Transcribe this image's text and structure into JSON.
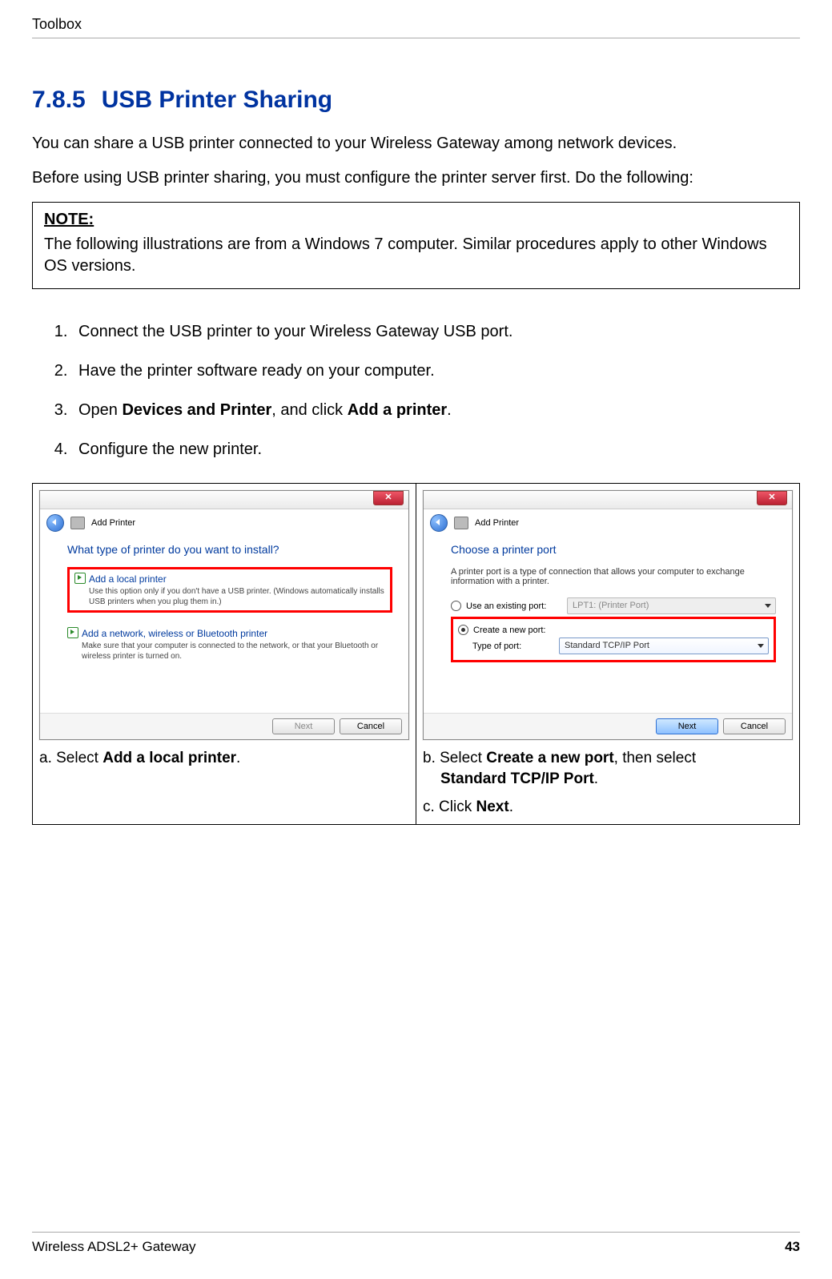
{
  "header": {
    "section": "Toolbox"
  },
  "heading": {
    "number": "7.8.5",
    "title": "USB Printer Sharing"
  },
  "intro1": "You can share a USB printer connected to your Wireless Gateway among network devices.",
  "intro2": "Before using USB printer sharing, you must configure the printer server first. Do the following:",
  "note": {
    "label": "NOTE:",
    "text": "The following illustrations are from a Windows 7 computer. Similar procedures apply to other Windows OS versions."
  },
  "steps": {
    "s1": "Connect the USB printer to your Wireless Gateway USB port.",
    "s2": "Have the printer software ready on your computer.",
    "s3_a": "Open ",
    "s3_b": "Devices and Printer",
    "s3_c": ", and click ",
    "s3_d": "Add a printer",
    "s3_e": ".",
    "s4": "Configure the new printer."
  },
  "dialogA": {
    "window_title": "Add Printer",
    "heading": "What type of printer do you want to install?",
    "opt1_title": "Add a local printer",
    "opt1_desc": "Use this option only if you don't have a USB printer. (Windows automatically installs USB printers when you plug them in.)",
    "opt2_title": "Add a network, wireless or Bluetooth printer",
    "opt2_desc": "Make sure that your computer is connected to the network, or that your Bluetooth or wireless printer is turned on.",
    "btn_next": "Next",
    "btn_cancel": "Cancel"
  },
  "dialogB": {
    "window_title": "Add Printer",
    "heading": "Choose a printer port",
    "sub": "A printer port is a type of connection that allows your computer to exchange information with a printer.",
    "opt_existing_label": "Use an existing port:",
    "opt_existing_value": "LPT1: (Printer Port)",
    "opt_new_label": "Create a new port:",
    "type_label": "Type of port:",
    "type_value": "Standard TCP/IP Port",
    "btn_next": "Next",
    "btn_cancel": "Cancel"
  },
  "captions": {
    "a_pre": "a. Select ",
    "a_bold": "Add a local printer",
    "a_post": ".",
    "b_pre": "b. Select ",
    "b_bold1": "Create a new port",
    "b_mid": ", then select ",
    "b_bold2": "Standard TCP/IP Port",
    "b_post": ".",
    "c_pre": "c. Click ",
    "c_bold": "Next",
    "c_post": "."
  },
  "footer": {
    "product": "Wireless ADSL2+ Gateway",
    "page": "43"
  }
}
